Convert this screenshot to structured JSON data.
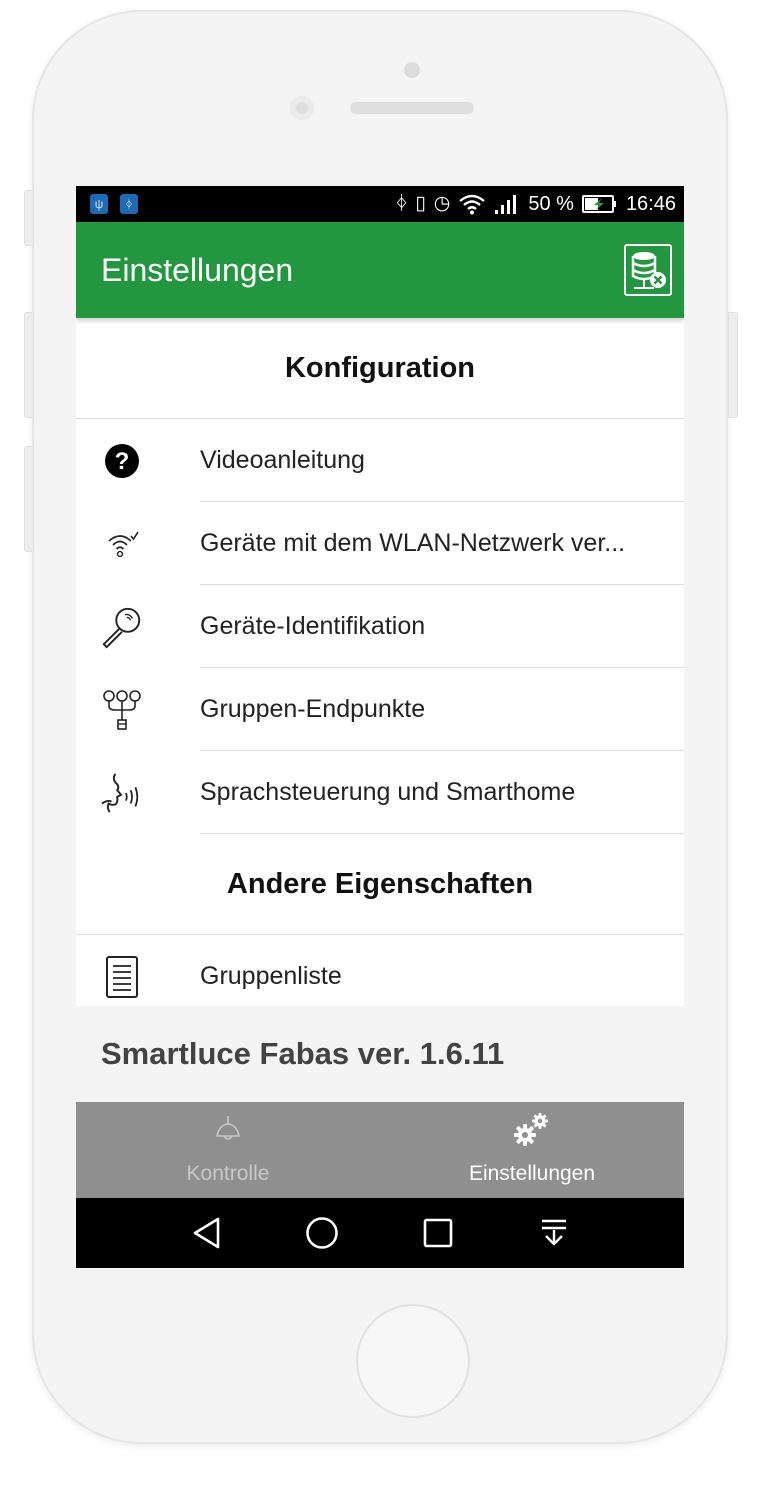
{
  "status_bar": {
    "notification_icons": [
      "usb-icon",
      "bluetooth-notif-icon"
    ],
    "system_icons": [
      "bluetooth-icon",
      "vibrate-icon",
      "alarm-icon",
      "wifi-icon",
      "signal-icon"
    ],
    "battery_text": "50 %",
    "time": "16:46"
  },
  "app_bar": {
    "title": "Einstellungen",
    "action_icon": "database-disconnect-icon"
  },
  "sections": [
    {
      "title": "Konfiguration",
      "items": [
        {
          "label": "Videoanleitung",
          "icon": "help-circle-icon"
        },
        {
          "label": "Geräte mit dem WLAN-Netzwerk ver...",
          "icon": "wifi-check-icon"
        },
        {
          "label": "Geräte-Identifikation",
          "icon": "magnifier-icon"
        },
        {
          "label": "Gruppen-Endpunkte",
          "icon": "group-endpoints-icon"
        },
        {
          "label": "Sprachsteuerung und Smarthome",
          "icon": "voice-control-icon"
        }
      ]
    },
    {
      "title": "Andere Eigenschaften",
      "items": [
        {
          "label": "Gruppenliste",
          "icon": "document-list-icon"
        }
      ]
    }
  ],
  "version": "Smartluce Fabas ver. 1.6.11",
  "bottom_nav": {
    "tabs": [
      {
        "label": "Kontrolle",
        "icon": "ceiling-lamp-icon",
        "active": false
      },
      {
        "label": "Einstellungen",
        "icon": "gears-icon",
        "active": true
      }
    ]
  },
  "system_nav": [
    "back-icon",
    "home-icon",
    "recents-icon",
    "notification-drawer-icon"
  ],
  "colors": {
    "app_bar": "#23973f",
    "bottom_nav": "#8f8f8f",
    "nav_active": "#ffffff",
    "nav_inactive": "#c8c8c8"
  }
}
